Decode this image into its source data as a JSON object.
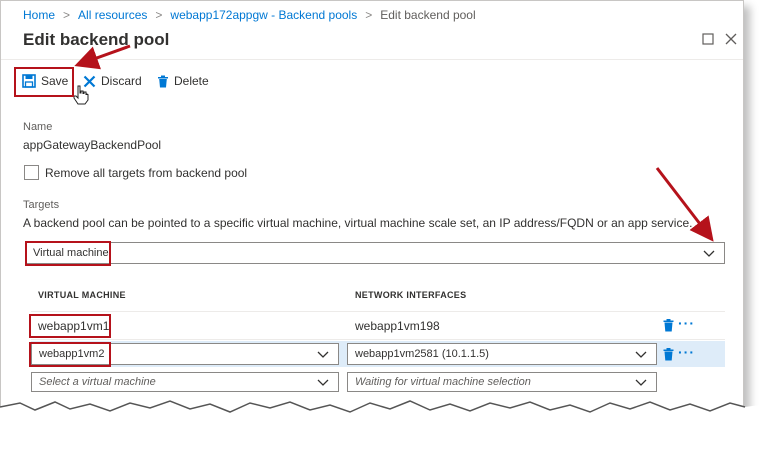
{
  "breadcrumb": {
    "items": [
      "Home",
      "All resources",
      "webapp172appgw - Backend pools",
      "Edit backend pool"
    ],
    "separator": ">"
  },
  "blade": {
    "title": "Edit backend pool"
  },
  "toolbar": {
    "save_label": "Save",
    "discard_label": "Discard",
    "delete_label": "Delete"
  },
  "form": {
    "name_label": "Name",
    "name_value": "appGatewayBackendPool",
    "remove_targets_label": "Remove all targets from backend pool",
    "remove_targets_checked": false,
    "targets_label": "Targets",
    "targets_description": "A backend pool can be pointed to a specific virtual machine, virtual machine scale set, an IP address/FQDN or an app service.",
    "target_type_value": "Virtual machine"
  },
  "table": {
    "columns": [
      "VIRTUAL MACHINE",
      "NETWORK INTERFACES"
    ],
    "rows": [
      {
        "vm": "webapp1vm1",
        "nic": "webapp1vm198"
      },
      {
        "vm": "webapp1vm2",
        "nic": "webapp1vm2581 (10.1.1.5)"
      }
    ],
    "new_row": {
      "vm_placeholder": "Select a virtual machine",
      "nic_placeholder": "Waiting for virtual machine selection"
    }
  },
  "colors": {
    "accent": "#0078d4",
    "annotation_red": "#b5121b",
    "selected_row": "#deecf9"
  }
}
